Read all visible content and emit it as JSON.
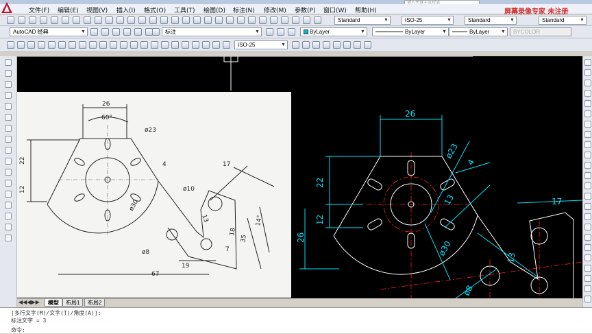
{
  "app": {
    "watermark": "屏幕录像专家 未注册",
    "search_placeholder": "键入关键字或短语"
  },
  "menu": [
    "文件(F)",
    "编辑(E)",
    "视图(V)",
    "插入(I)",
    "格式(O)",
    "工具(T)",
    "绘图(D)",
    "标注(N)",
    "修改(M)",
    "参数(P)",
    "窗口(W)",
    "帮助(H)"
  ],
  "toolbar1": {
    "text_style": "Standard",
    "dim_style": "ISO-25",
    "table_style": "Standard",
    "multileader_style": "Standard"
  },
  "toolbar2": {
    "workspace": "AutoCAD 经典",
    "layer": "标注",
    "color": "ByLayer",
    "linetype": "ByLayer",
    "lineweight": "ByLayer",
    "plotstyle": "BYCOLOR"
  },
  "toolbar3": {
    "dim_style": "ISO-25"
  },
  "tabs": [
    "模型",
    "布局1",
    "布局2"
  ],
  "command": {
    "line1": "[多行文字(M)/文字(T)/角度(A)]:",
    "line2": "标注文字 = 3",
    "line3": "命令:"
  },
  "reference_dims": [
    "26",
    "60°",
    "ø23",
    "22",
    "12",
    "4",
    "ø30",
    "17",
    "ø10",
    "13",
    "7",
    "18",
    "35",
    "14°",
    "ø8",
    "19",
    "67"
  ],
  "cad_dims": [
    "26",
    "ø23",
    "4",
    "22",
    "12",
    "26",
    "13",
    "ø30",
    "17",
    "13",
    "ø8"
  ],
  "colors": {
    "canvas": "#000000",
    "dim_cyan": "#00e5ff",
    "center_red": "#ff2020",
    "geometry": "#ffffff"
  }
}
